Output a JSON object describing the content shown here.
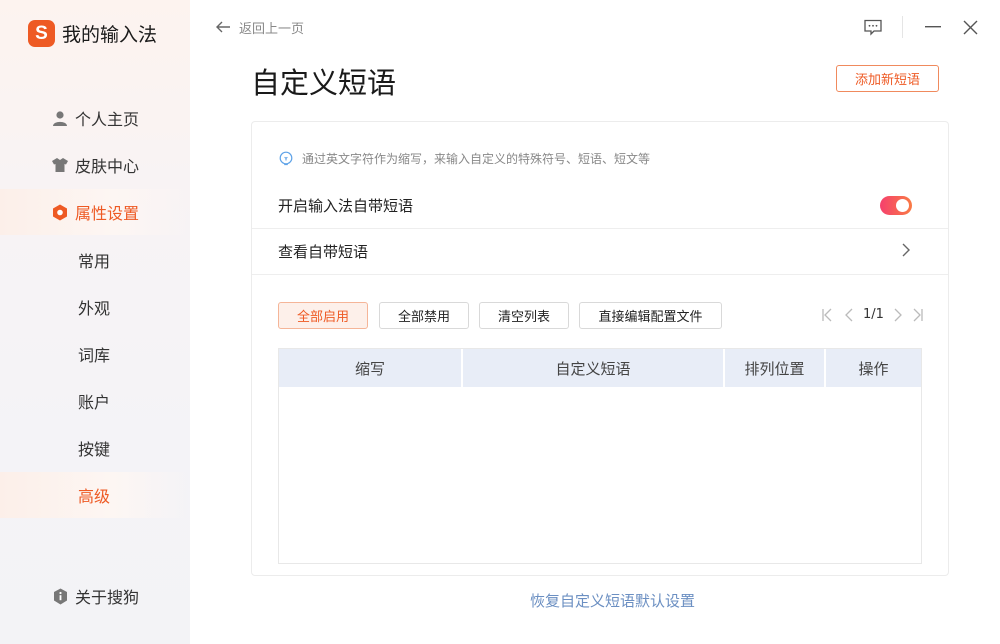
{
  "app": {
    "logo_letter": "S",
    "title": "我的输入法"
  },
  "sidebar": {
    "nav": [
      {
        "label": "个人主页",
        "icon": "user-icon"
      },
      {
        "label": "皮肤中心",
        "icon": "shirt-icon"
      },
      {
        "label": "属性设置",
        "icon": "hexagon-settings-icon"
      }
    ],
    "sub": [
      {
        "label": "常用"
      },
      {
        "label": "外观"
      },
      {
        "label": "词库"
      },
      {
        "label": "账户"
      },
      {
        "label": "按键"
      },
      {
        "label": "高级"
      }
    ],
    "about": {
      "label": "关于搜狗",
      "icon": "info-shield-icon"
    }
  },
  "header": {
    "back_label": "返回上一页",
    "back_icon": "arrow-left-icon"
  },
  "window": {
    "feedback_icon": "feedback-icon",
    "minimize_icon": "minimize-icon",
    "close_icon": "close-icon"
  },
  "page": {
    "title": "自定义短语",
    "add_button": "添加新短语"
  },
  "panel": {
    "hint": "通过英文字符作为缩写，来输入自定义的特殊符号、短语、短文等",
    "enable_label": "开启输入法自带短语",
    "enable_on": true,
    "view_label": "查看自带短语"
  },
  "toolbar": {
    "enable_all": "全部启用",
    "disable_all": "全部禁用",
    "clear_list": "清空列表",
    "edit_config": "直接编辑配置文件"
  },
  "pager": {
    "text": "1/1"
  },
  "table": {
    "headers": [
      "缩写",
      "自定义短语",
      "排列位置",
      "操作"
    ]
  },
  "footer": {
    "restore": "恢复自定义短语默认设置"
  },
  "colors": {
    "accent": "#ee5a24",
    "link": "#6b8fc2",
    "table_header_bg": "#e8edf7"
  }
}
